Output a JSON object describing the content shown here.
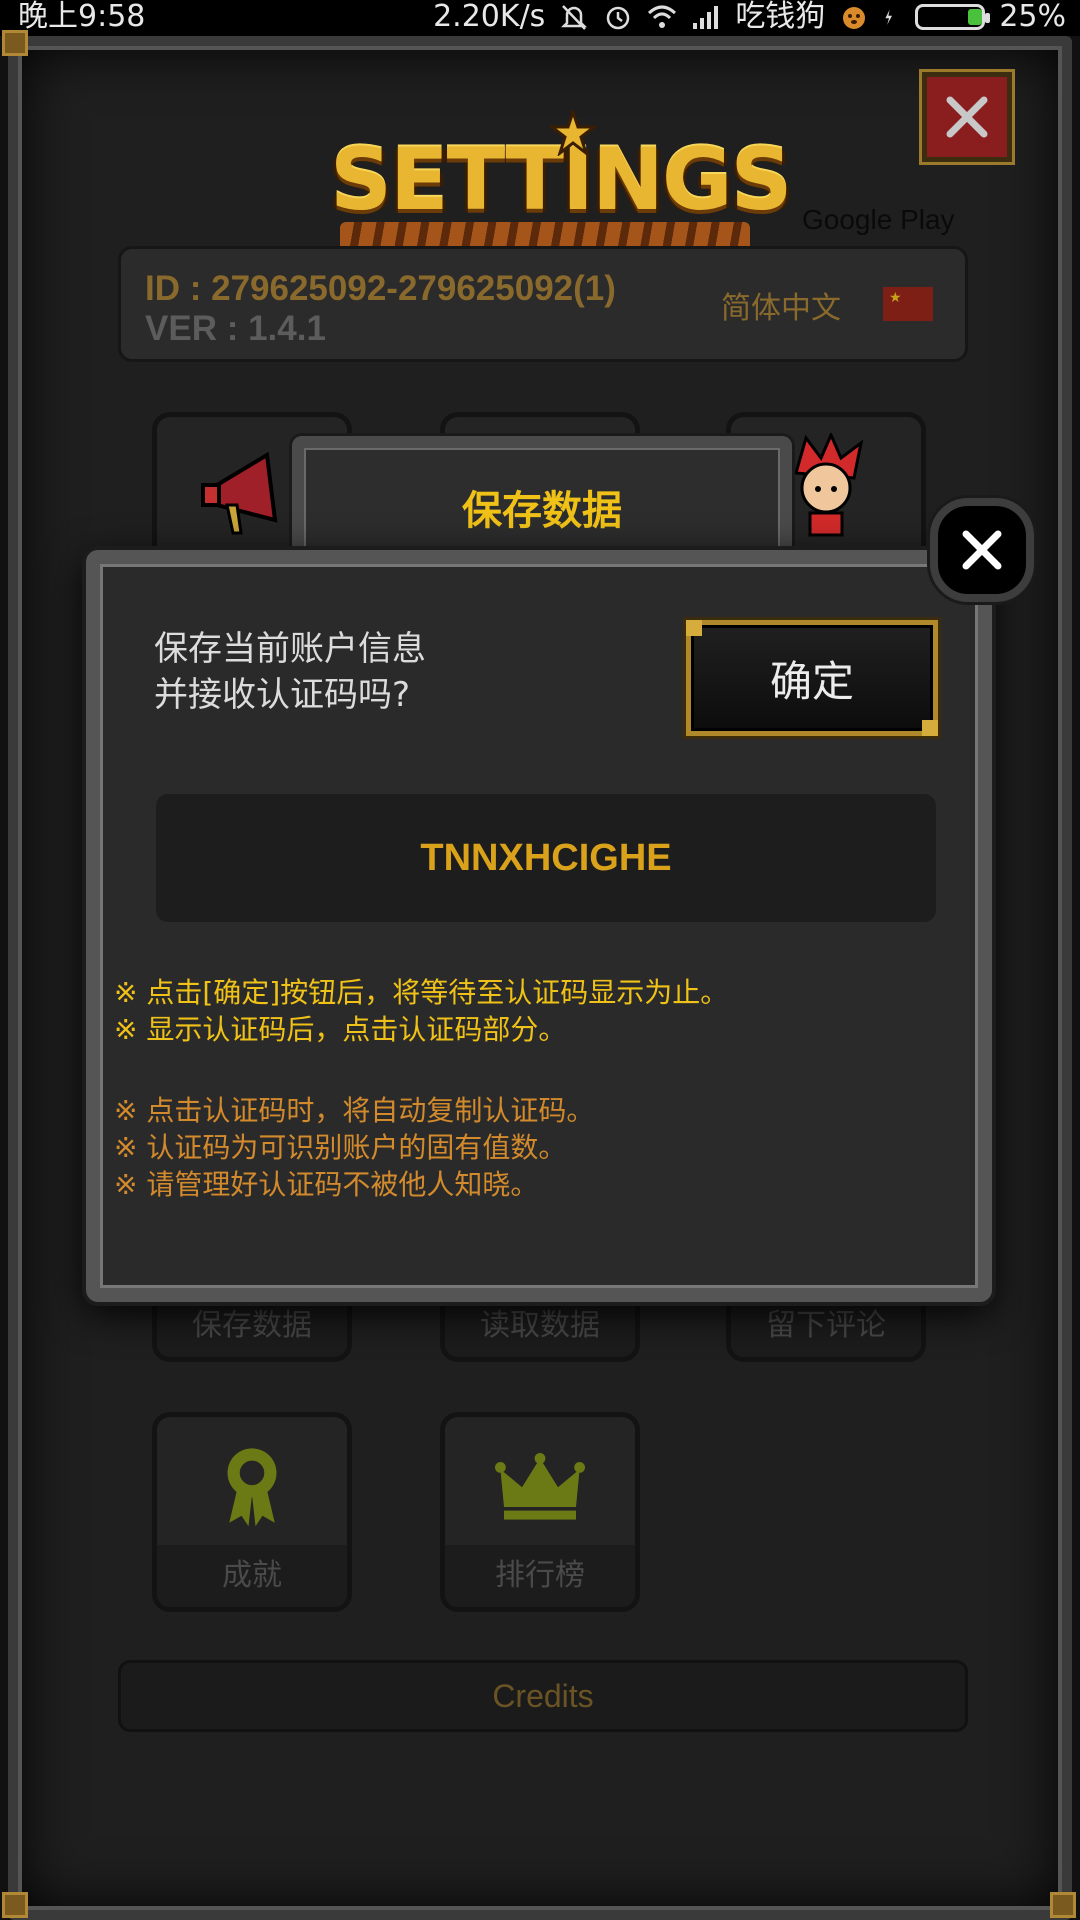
{
  "status_bar": {
    "time": "晚上9:58",
    "net_speed": "2.20K/s",
    "carrier": "吃钱狗",
    "battery": "25%",
    "battery_level": 0.25
  },
  "settings": {
    "logo_text": "SETTINGS",
    "google_play": "Google Play",
    "id_line": "ID : 279625092-279625092(1)",
    "ver_line": "VER : 1.4.1",
    "language": "简体中文",
    "flag_icon": "china-flag-icon",
    "tiles": {
      "save": "保存数据",
      "load": "读取数据",
      "review": "留下评论",
      "achievements": "成就",
      "leaderboard": "排行榜"
    },
    "credits": "Credits"
  },
  "dialog": {
    "title": "保存数据",
    "message_line1": "保存当前账户信息",
    "message_line2": "并接收认证码吗?",
    "ok_label": "确定",
    "code": "TNNXHCIGHE",
    "notes_primary": [
      "※ 点击[确定]按钮后，将等待至认证码显示为止。",
      "※ 显示认证码后，点击认证码部分。"
    ],
    "notes_secondary": [
      "※ 点击认证码时，将自动复制认证码。",
      "※ 认证码为可识别账户的固有值数。",
      "※ 请管理好认证码不被他人知晓。"
    ]
  },
  "colors": {
    "accent_gold": "#f0c218",
    "code_gold": "#d9a21a",
    "note_orange": "#d28a2c",
    "close_red": "#8a1d1d"
  }
}
